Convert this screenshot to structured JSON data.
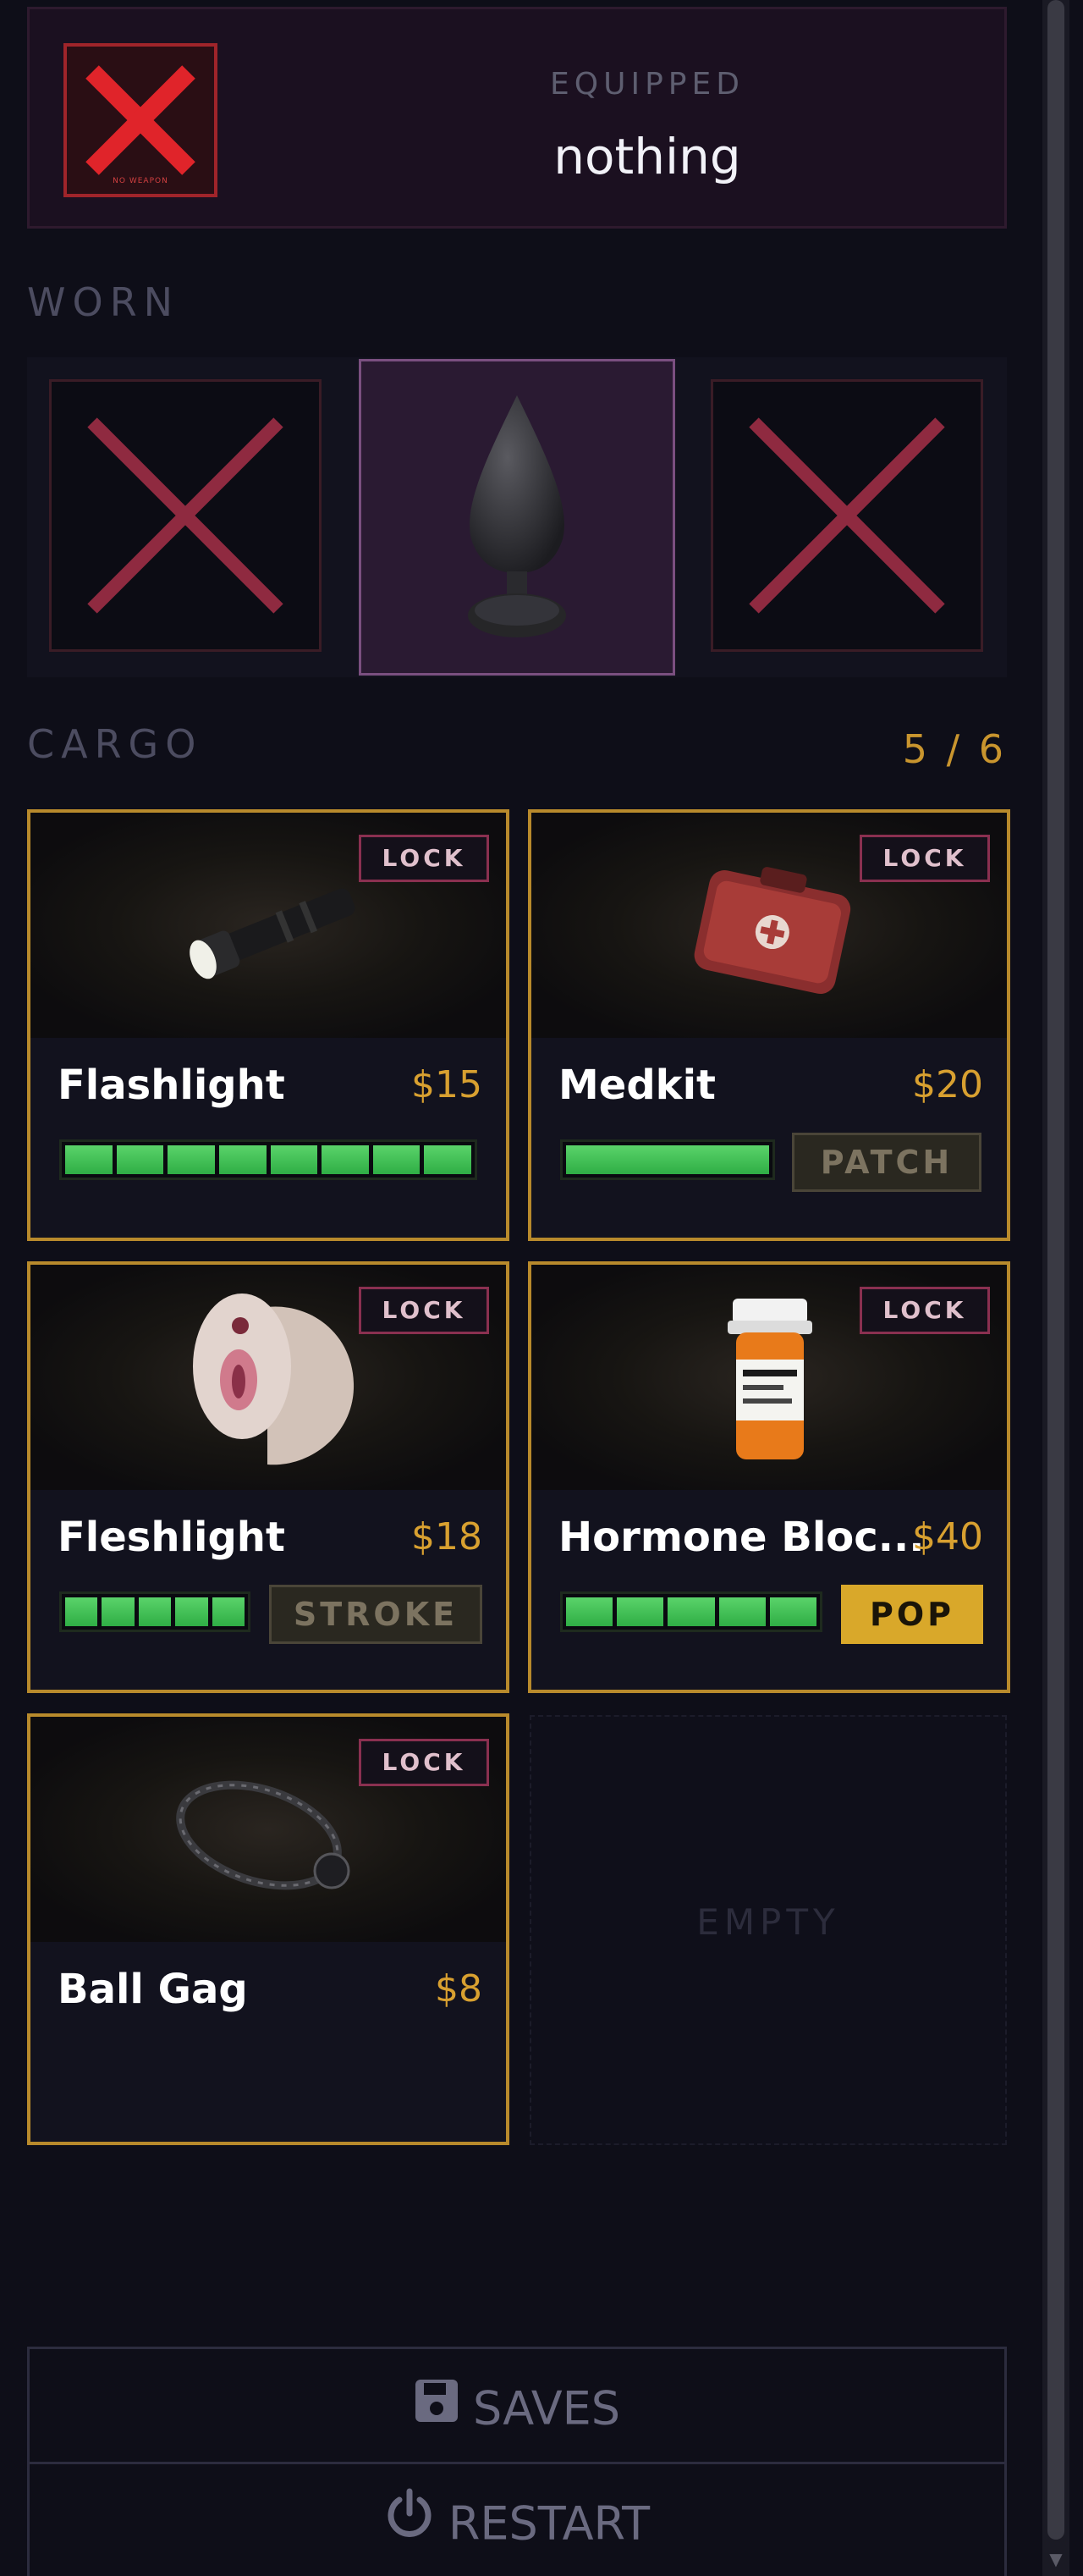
{
  "equipped": {
    "caption": "EQUIPPED",
    "value": "nothing",
    "thumb_text": "NO WEAPON"
  },
  "worn": {
    "label": "WORN",
    "slots": [
      {
        "state": "empty",
        "icon": "x-icon"
      },
      {
        "state": "filled",
        "icon": "plug-icon"
      },
      {
        "state": "empty",
        "icon": "x-icon"
      }
    ]
  },
  "cargo": {
    "label": "CARGO",
    "count": "5 / 6",
    "lock_label": "LOCK",
    "empty_label": "EMPTY",
    "items": [
      {
        "name": "Flashlight",
        "price": "$15",
        "bar_segments": 8,
        "bar_filled": 8,
        "icon": "flashlight-icon"
      },
      {
        "name": "Medkit",
        "price": "$20",
        "bar_segments": 1,
        "bar_filled": 1,
        "action": "PATCH",
        "action_active": false,
        "icon": "medkit-icon"
      },
      {
        "name": "Fleshlight",
        "price": "$18",
        "bar_segments": 5,
        "bar_filled": 5,
        "action": "STROKE",
        "action_active": false,
        "icon": "fleshlight-icon"
      },
      {
        "name": "Hormone Bloc...",
        "price": "$40",
        "bar_segments": 5,
        "bar_filled": 5,
        "action": "POP",
        "action_active": true,
        "icon": "pill-bottle-icon"
      },
      {
        "name": "Ball Gag",
        "price": "$8",
        "icon": "ball-gag-icon"
      }
    ]
  },
  "menu": {
    "saves_label": "SAVES",
    "restart_label": "RESTART"
  },
  "colors": {
    "background": "#0e0e18",
    "accent_gold": "#b88a2c",
    "bar_green": "#3fc156",
    "lock_border": "#8a3050",
    "x_red": "#8f2a40"
  }
}
